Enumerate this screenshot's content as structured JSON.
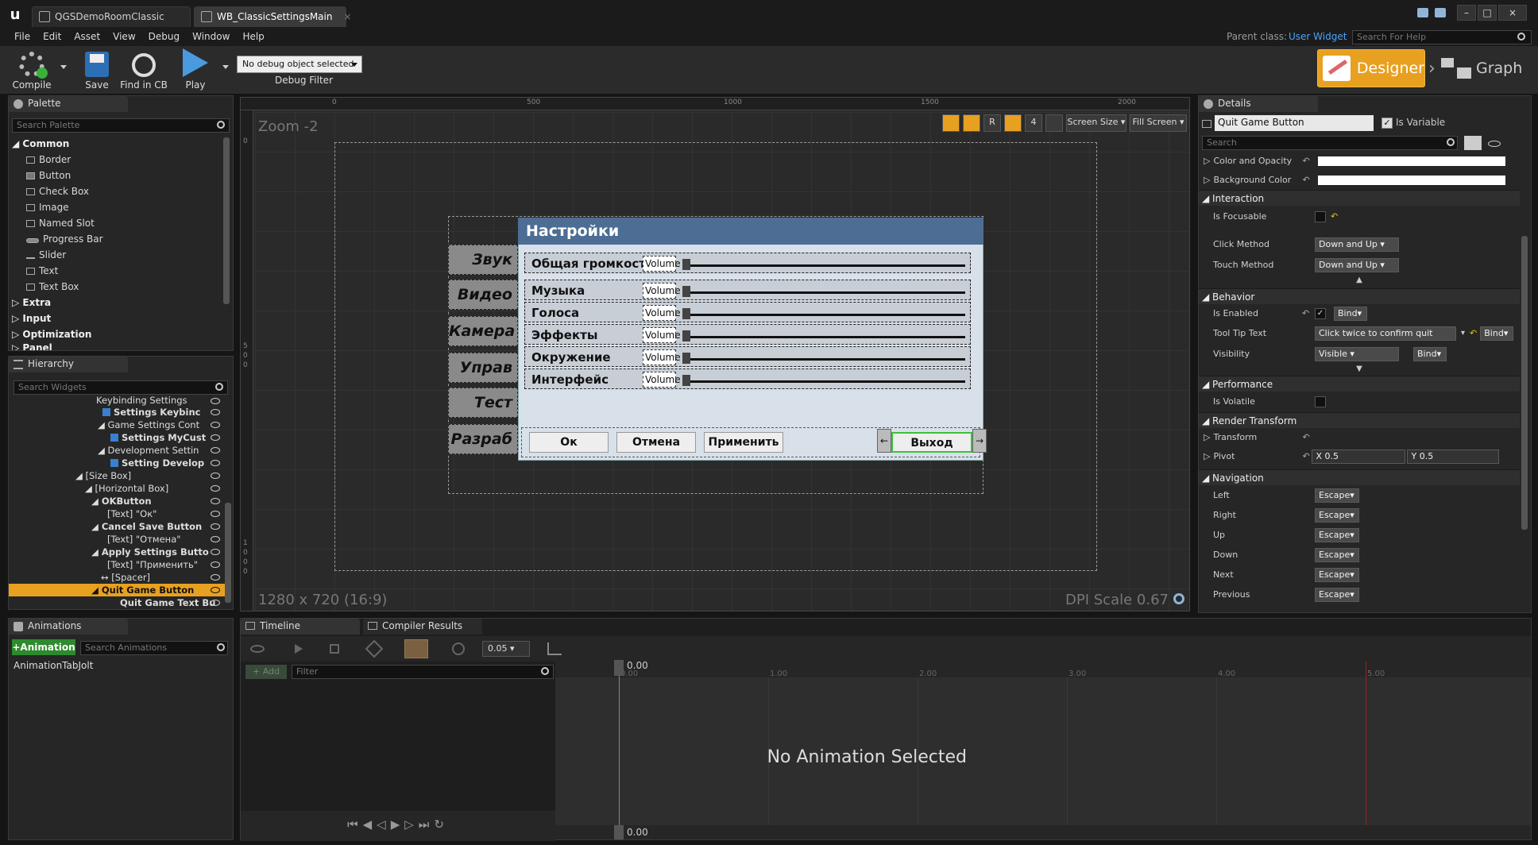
{
  "tabs": [
    {
      "label": "QGSDemoRoomClassic"
    },
    {
      "label": "WB_ClassicSettingsMain"
    }
  ],
  "menu": [
    "File",
    "Edit",
    "Asset",
    "View",
    "Debug",
    "Window",
    "Help"
  ],
  "parent_class": {
    "label": "Parent class:",
    "value": "User Widget"
  },
  "help_search": {
    "placeholder": "Search For Help"
  },
  "toolbar": {
    "compile": "Compile",
    "save": "Save",
    "find_in_cb": "Find in CB",
    "play": "Play",
    "debug_object": "No debug object selected",
    "debug_filter": "Debug Filter"
  },
  "modes": {
    "designer": "Designer",
    "graph": "Graph"
  },
  "palette": {
    "title": "Palette",
    "search_placeholder": "Search Palette",
    "categories": {
      "common": "Common",
      "extra": "Extra",
      "input": "Input",
      "optimization": "Optimization",
      "panel": "Panel"
    },
    "items": [
      "Border",
      "Button",
      "Check Box",
      "Image",
      "Named Slot",
      "Progress Bar",
      "Slider",
      "Text",
      "Text Box"
    ]
  },
  "hierarchy": {
    "title": "Hierarchy",
    "search_placeholder": "Search Widgets",
    "rows": [
      "Keybinding Settings",
      "Settings Keybinc",
      "Game Settings Cont",
      "Settings MyCust",
      "Development Settin",
      "Setting Develop",
      "[Size Box]",
      "[Horizontal Box]",
      "OKButton",
      "[Text] \"Ок\"",
      "Cancel Save Button",
      "[Text] \"Отмена\"",
      "Apply Settings Butto",
      "[Text] \"Применить\"",
      "[Spacer]",
      "Quit Game Button",
      "Quit Game Text Bu"
    ]
  },
  "canvas": {
    "zoom": "Zoom -2",
    "ruler": [
      "0",
      "500",
      "1000",
      "1500",
      "2000"
    ],
    "resolution": "1280 x 720 (16:9)",
    "dpi": "DPI Scale 0.67",
    "screen_size": "Screen Size",
    "fill_screen": "Fill Screen",
    "r_btn": "R",
    "grid_num": "4",
    "vruler": [
      "0",
      "5",
      "0",
      "0",
      "1",
      "0",
      "0",
      "0"
    ]
  },
  "widget": {
    "title": "Настройки",
    "side_tabs": [
      "Звук",
      "Видео",
      "Камера",
      "Управ",
      "Тест",
      "Разраб"
    ],
    "rows": [
      {
        "label": "Общая громкость",
        "tag": "Volume"
      },
      {
        "label": "Музыка",
        "tag": "Volume"
      },
      {
        "label": "Голоса",
        "tag": "Volume"
      },
      {
        "label": "Эффекты",
        "tag": "Volume"
      },
      {
        "label": "Окружение",
        "tag": "Volume"
      },
      {
        "label": "Интерфейс",
        "tag": "Volume"
      }
    ],
    "buttons": {
      "ok": "Ок",
      "cancel": "Отмена",
      "apply": "Применить",
      "quit": "Выход"
    }
  },
  "details": {
    "title": "Details",
    "name_value": "Quit Game Button",
    "is_variable": "Is Variable",
    "search_placeholder": "Search",
    "color_opacity": "Color and Opacity",
    "background_color": "Background Color",
    "sections": {
      "interaction": "Interaction",
      "behavior": "Behavior",
      "performance": "Performance",
      "render_transform": "Render Transform",
      "navigation": "Navigation"
    },
    "is_focusable": "Is Focusable",
    "click_method": {
      "label": "Click Method",
      "value": "Down and Up"
    },
    "touch_method": {
      "label": "Touch Method",
      "value": "Down and Up"
    },
    "is_enabled": "Is Enabled",
    "bind": "Bind",
    "tooltip": {
      "label": "Tool Tip Text",
      "value": "Click twice to confirm quit"
    },
    "visibility": {
      "label": "Visibility",
      "value": "Visible"
    },
    "is_volatile": "Is Volatile",
    "transform": "Transform",
    "pivot": {
      "label": "Pivot",
      "x_label": "X",
      "x": "0.5",
      "y_label": "Y",
      "y": "0.5"
    },
    "nav": [
      {
        "label": "Left",
        "value": "Escape"
      },
      {
        "label": "Right",
        "value": "Escape"
      },
      {
        "label": "Up",
        "value": "Escape"
      },
      {
        "label": "Down",
        "value": "Escape"
      },
      {
        "label": "Next",
        "value": "Escape"
      },
      {
        "label": "Previous",
        "value": "Escape"
      }
    ]
  },
  "animations": {
    "title": "Animations",
    "add_button": "+Animation",
    "search_placeholder": "Search Animations",
    "items": [
      "AnimationTabJolt"
    ]
  },
  "timeline": {
    "tab": "Timeline",
    "compiler_tab": "Compiler Results",
    "snap_value": "0.05",
    "add": "+ Add",
    "filter_placeholder": "Filter",
    "time": "0.00",
    "ticks": [
      "0.00",
      "1.00",
      "2.00",
      "3.00",
      "4.00",
      "5.00"
    ],
    "empty": "No Animation Selected"
  }
}
